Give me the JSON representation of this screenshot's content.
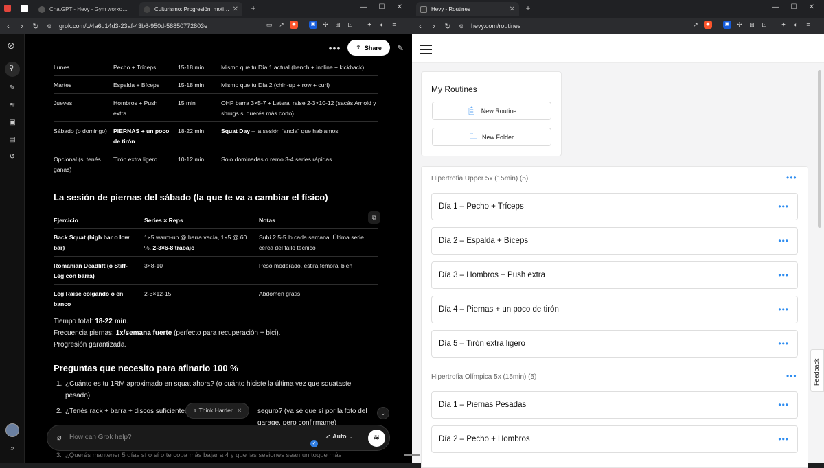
{
  "left_browser": {
    "tabs": [
      {
        "title": "ChatGPT - Hevy - Gym workout plan",
        "active": false
      },
      {
        "title": "Culturismo: Progresión, motivaci",
        "active": true
      }
    ],
    "url": "grok.com/c/4a6d14d3-23af-43b6-950d-58850772803e"
  },
  "right_browser": {
    "tabs": [
      {
        "title": "Hevy - Routines",
        "active": true
      }
    ],
    "url": "hevy.com/routines"
  },
  "grok": {
    "share_label": "Share",
    "schedule_rows": [
      {
        "day": "Lunes",
        "session": "Pecho + Tríceps",
        "duration": "15-18 min",
        "note": "Mismo que tu Día 1 actual (bench + incline + kickback)"
      },
      {
        "day": "Martes",
        "session": "Espalda + Bíceps",
        "duration": "15-18 min",
        "note": "Mismo que tu Día 2 (chin-up + row + curl)"
      },
      {
        "day": "Jueves",
        "session": "Hombros + Push extra",
        "duration": "15 min",
        "note": "OHP barra 3×5-7 + Lateral raise 2-3×10-12 (sacás Arnold y shrugs si querés más corto)"
      },
      {
        "day": "Sábado (o domingo)",
        "session": "PIERNAS + un poco de tirón",
        "duration": "18-22 min",
        "note_bold": "Squat Day",
        "note": " – la sesión “ancla” que hablamos"
      },
      {
        "day": "Opcional (si tenés ganas)",
        "session": "Tirón extra ligero",
        "duration": "10-12 min",
        "note": "Solo dominadas o remo 3-4 series rápidas"
      }
    ],
    "legs_heading": "La sesión de piernas del sábado (la que te va a cambiar el físico)",
    "legs_headers": [
      "Ejercicio",
      "Series × Reps",
      "Notas"
    ],
    "legs_rows": [
      {
        "exercise": "Back Squat (high bar o low bar)",
        "sets": "1×5 warm-up @ barra vacía, 1×5 @ 60 %, ",
        "sets_bold": "2-3×6-8 trabajo",
        "notes": "Subí 2.5-5 lb cada semana. Última serie cerca del fallo técnico"
      },
      {
        "exercise": "Romanian Deadlift (o Stiff-Leg con barra)",
        "sets": "3×8-10",
        "sets_bold": "",
        "notes": "Peso moderado, estira femoral bien"
      },
      {
        "exercise": "Leg Raise colgando o en banco",
        "sets": "2-3×12-15",
        "sets_bold": "",
        "notes": "Abdomen gratis"
      }
    ],
    "summary": {
      "total_label": "Tiempo total: ",
      "total_value": "18-22 min",
      "total_end": ".",
      "freq_label": "Frecuencia piernas: ",
      "freq_value": "1x/semana fuerte",
      "freq_rest": " (perfecto para recuperación + bici).",
      "progress": "Progresión garantizada."
    },
    "questions_heading": "Preguntas que necesito para afinarlo 100 %",
    "questions": [
      "¿Cuánto es tu 1RM aproximado en squat ahora? (o cuánto hiciste la última vez que squataste pesado)",
      "¿Tenés rack + barra + discos suficientes",
      "seguro? (ya sé que sí por la foto del garage, pero confirmame)",
      "¿Querés mantener 5 días sí o sí o te copa más bajar a 4 y que las sesiones sean un toque más"
    ],
    "think_harder": "Think Harder",
    "input_placeholder": "How can Grok help?",
    "mode_label": "Auto"
  },
  "hevy": {
    "my_routines_title": "My Routines",
    "new_routine": "New Routine",
    "new_folder": "New Folder",
    "groups": [
      {
        "name": "Hipertrofia Upper 5x (15min) (5)",
        "routines": [
          "Día 1 – Pecho + Tríceps",
          "Día 2 – Espalda + Bíceps",
          "Día 3 – Hombros + Push extra",
          "Día 4 – Piernas + un poco de tirón",
          "Día 5 – Tirón extra ligero"
        ]
      },
      {
        "name": "Hipertrofia Olímpica 5x (15min) (5)",
        "routines": [
          "Día 1 – Piernas Pesadas",
          "Día 2 – Pecho + Hombros"
        ]
      }
    ],
    "feedback": "Feedback"
  },
  "colors": {
    "brand_blue": "#2d8cf0",
    "grok_bg": "#000000",
    "hevy_bg": "#f4f4f5"
  }
}
